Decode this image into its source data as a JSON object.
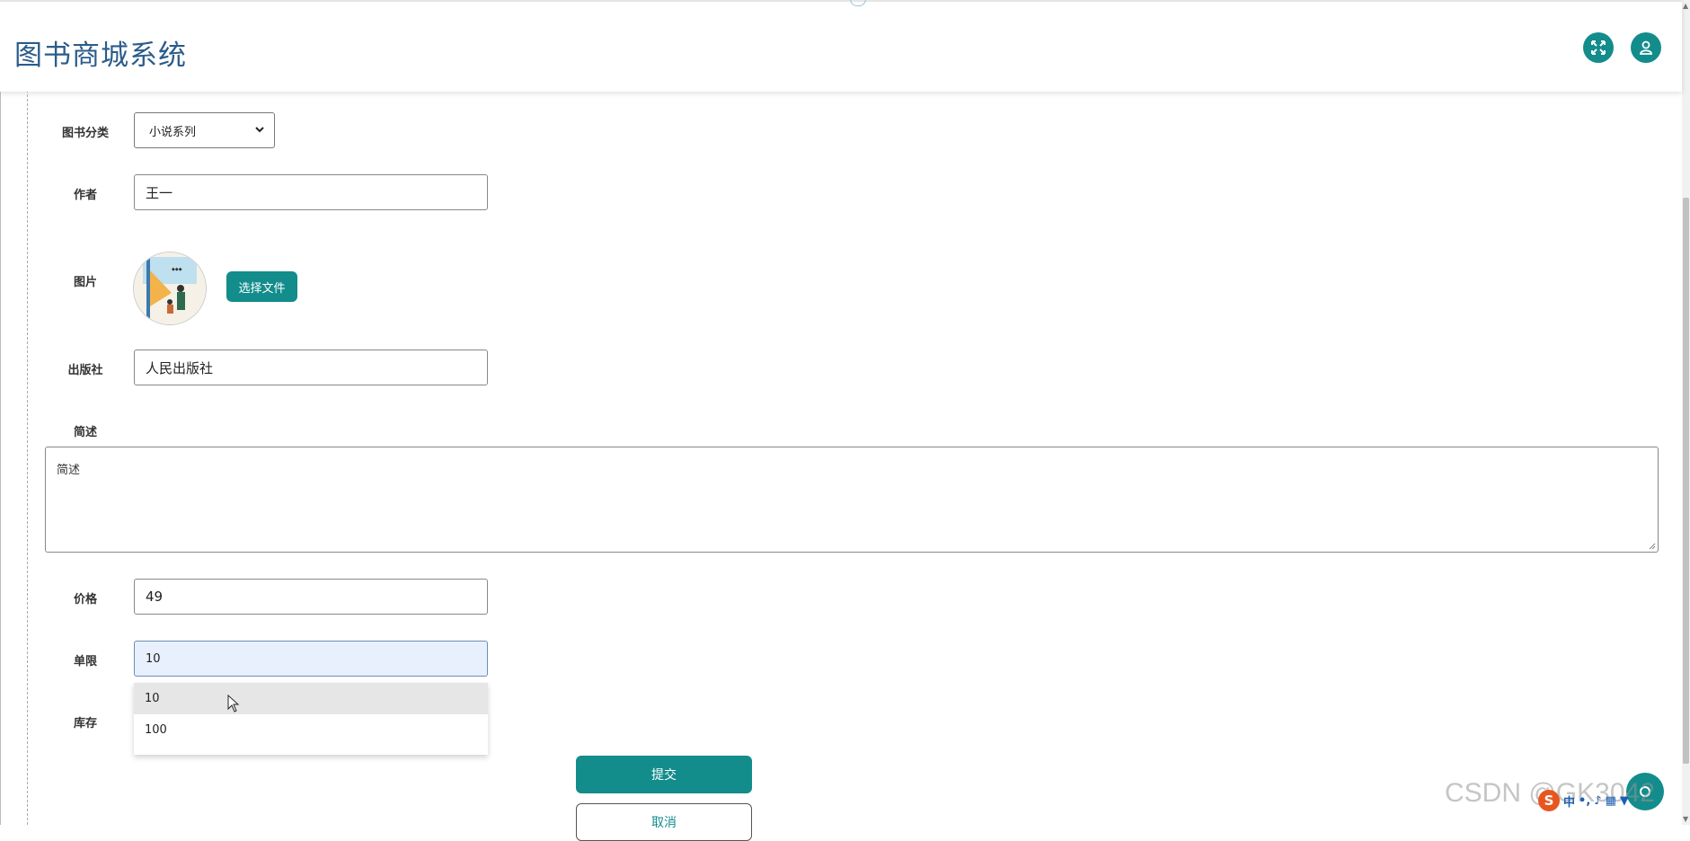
{
  "header": {
    "title": "图书商城系统"
  },
  "form": {
    "category": {
      "label": "图书分类",
      "value": "小说系列"
    },
    "author": {
      "label": "作者",
      "value": "王一"
    },
    "image": {
      "label": "图片",
      "button": "选择文件"
    },
    "publisher": {
      "label": "出版社",
      "value": "人民出版社"
    },
    "summary": {
      "label": "简述",
      "placeholder": "简述"
    },
    "price": {
      "label": "价格",
      "value": "49"
    },
    "limit": {
      "label": "单限",
      "value": "10",
      "options": [
        "10",
        "100"
      ]
    },
    "stock": {
      "label": "库存"
    },
    "submit": "提交",
    "cancel": "取消"
  },
  "watermark": "CSDN @GK3042",
  "ime": {
    "logo": "S",
    "mode": "中"
  },
  "colors": {
    "accent": "#138c8c",
    "title": "#2b5c8a",
    "autofill": "#e8f0fe"
  },
  "icons": [
    "fullscreen-icon",
    "user-icon",
    "select-caret-icon",
    "cursor-icon"
  ]
}
